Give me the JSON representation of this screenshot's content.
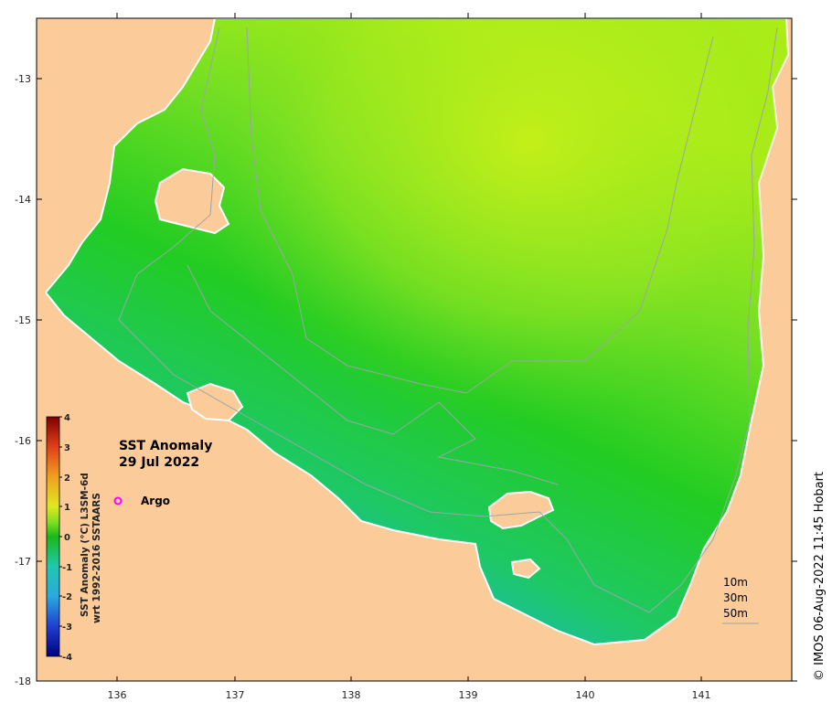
{
  "map": {
    "title_line1": "SST Anomaly",
    "title_line2": "29 Jul 2022",
    "legend_argo": "Argo",
    "argo_color": "#ff00ff",
    "credit": "© IMOS 06-Aug-2022 11:45 Hobart",
    "land_color": "#fccb9a",
    "lon_ticks": [
      "136",
      "137",
      "138",
      "139",
      "140",
      "141"
    ],
    "lat_ticks": [
      "-13",
      "-14",
      "-15",
      "-16",
      "-17",
      "-18"
    ],
    "colorbar": {
      "title_line1": "SST Anomaly (°C) L3SM-6d",
      "title_line2": "wrt 1992-2016 SSTAARS",
      "ticks": [
        "4",
        "3",
        "2",
        "1",
        "0",
        "-1",
        "-2",
        "-3",
        "-4"
      ],
      "range": [
        -4,
        4
      ]
    },
    "isobaths": [
      "10m",
      "30m",
      "50m"
    ]
  }
}
